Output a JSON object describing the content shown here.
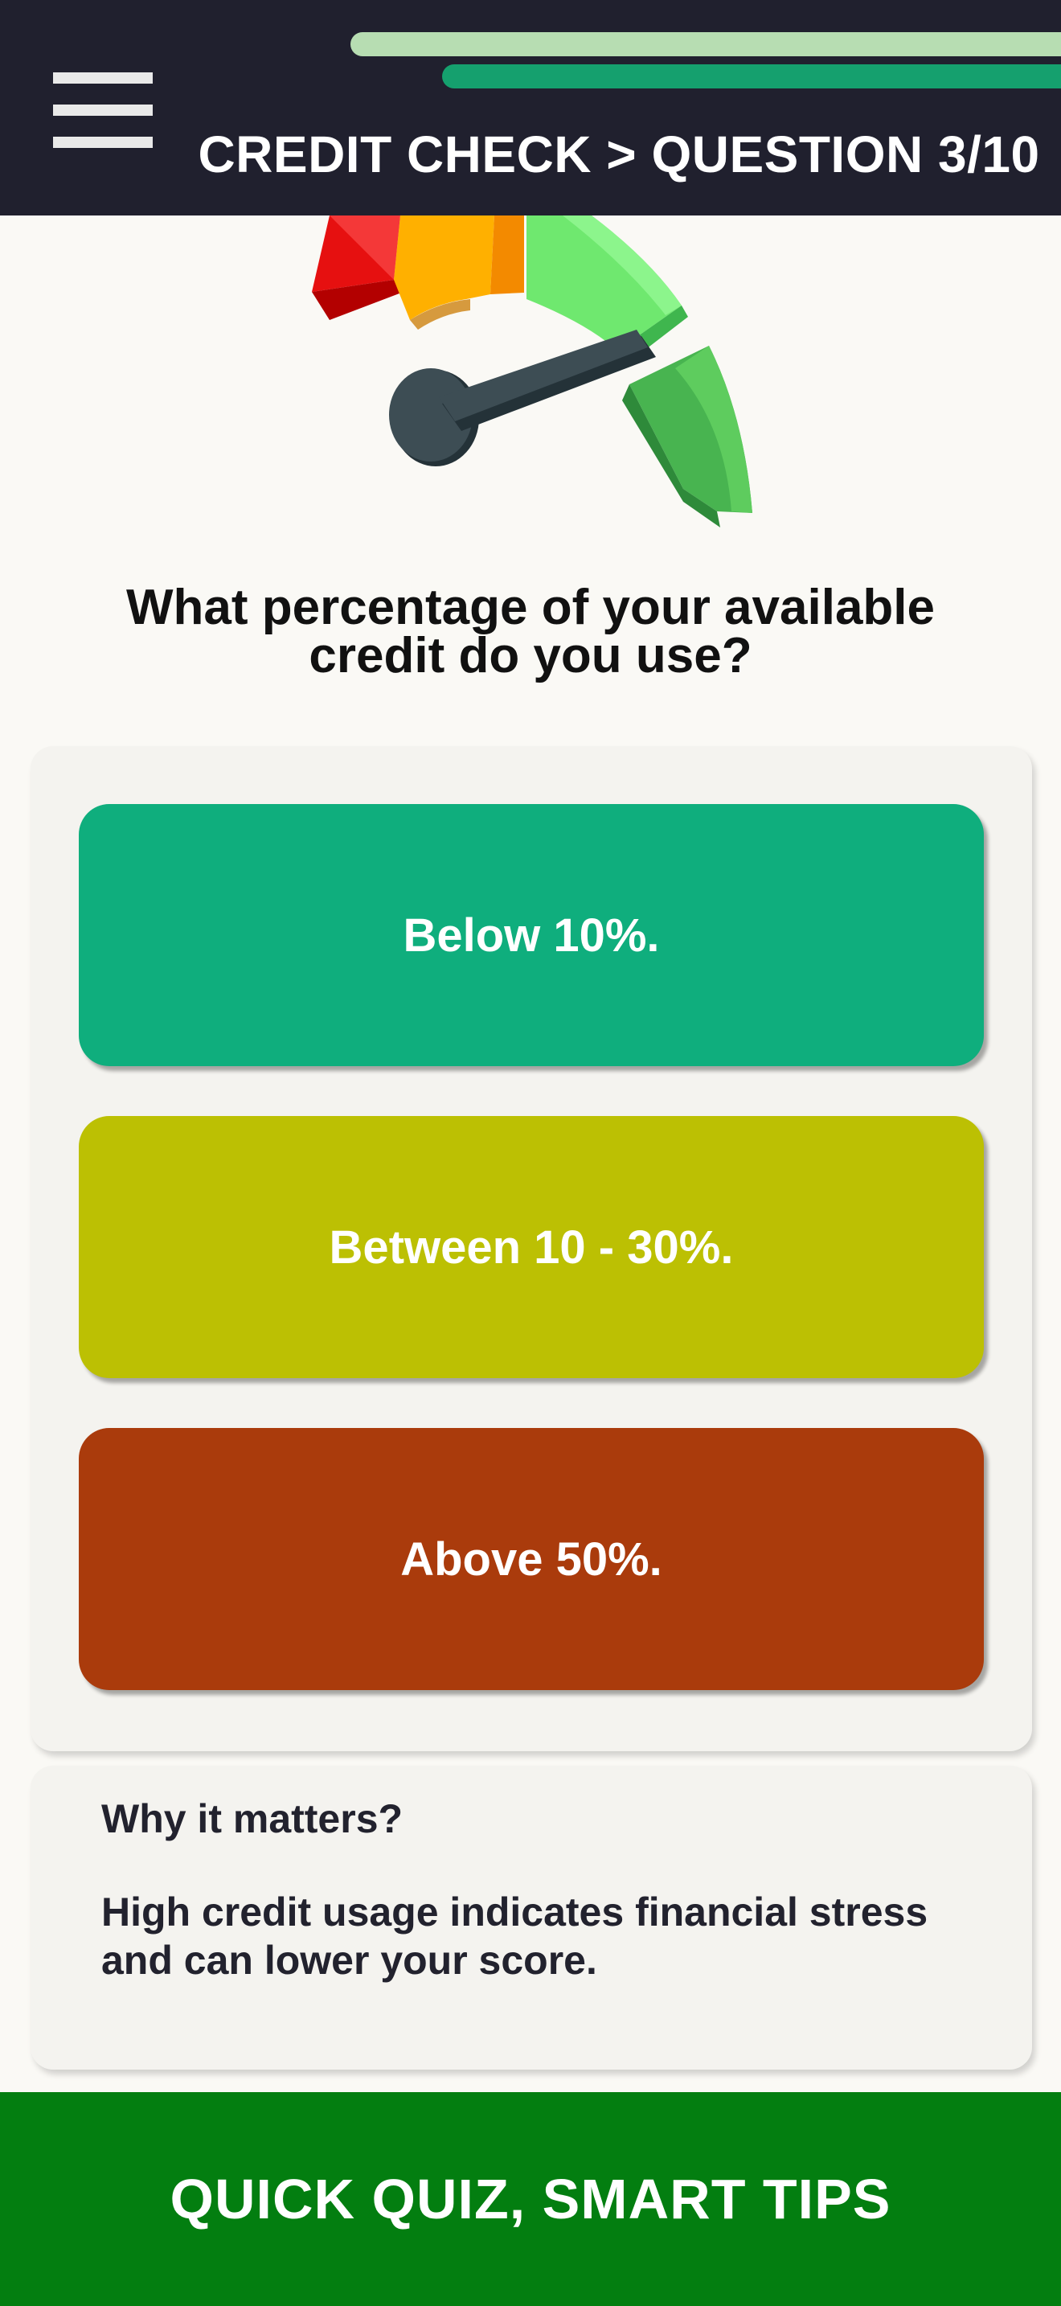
{
  "header": {
    "title": "CREDIT CHECK > QUESTION 3/10",
    "menu_icon": "hamburger-menu-icon"
  },
  "illustration": {
    "icon": "credit-score-gauge-icon"
  },
  "question": {
    "text": "What percentage of your available credit do you use?"
  },
  "options": [
    {
      "label": "Below 10%.",
      "color": "#0fae7d"
    },
    {
      "label": "Between 10 - 30%.",
      "color": "#bcc003"
    },
    {
      "label": "Above 50%.",
      "color": "#aa3b0c"
    }
  ],
  "info": {
    "title": "Why it matters?",
    "text": "High credit usage indicates financial stress and can lower your score."
  },
  "footer": {
    "text": "QUICK QUIZ, SMART TIPS"
  },
  "colors": {
    "header_bg": "#20202e",
    "footer_bg": "#037e10",
    "page_bg": "#faf9f5"
  }
}
